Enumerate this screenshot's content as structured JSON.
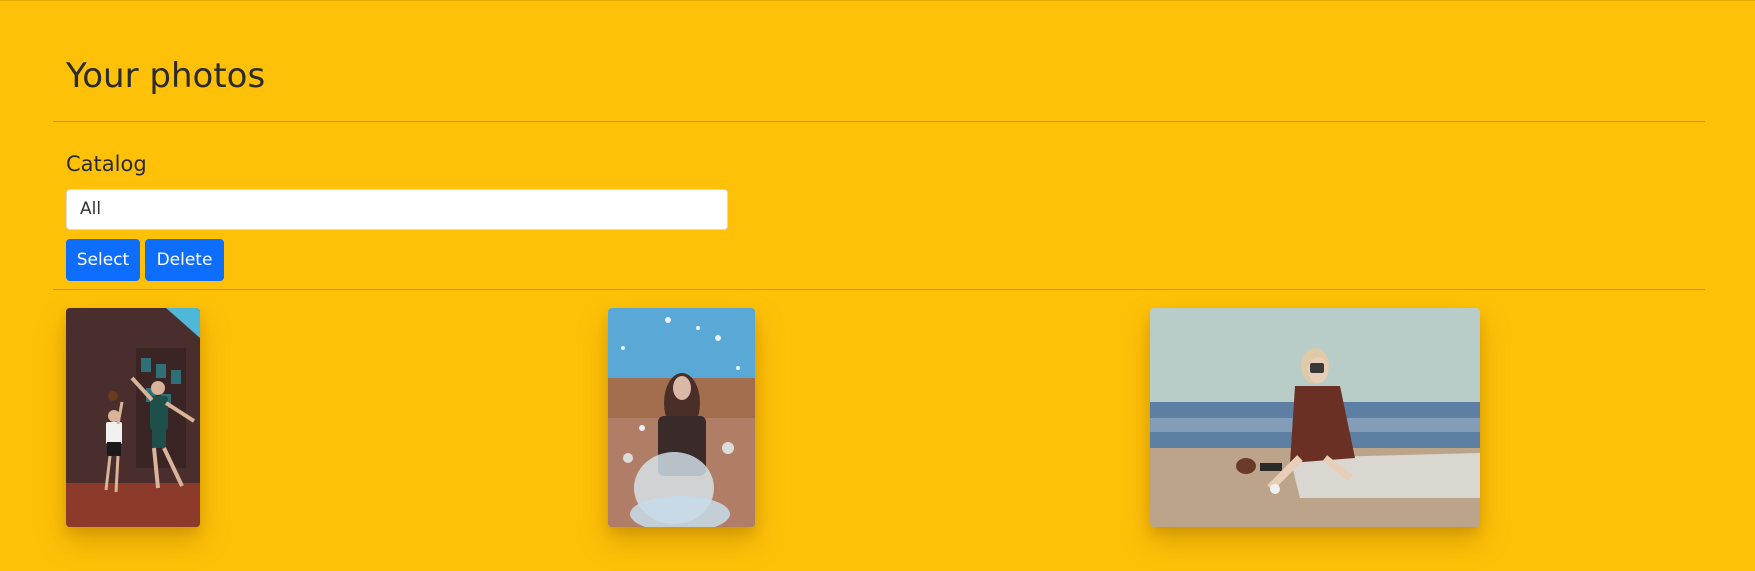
{
  "header": {
    "title": "Your photos"
  },
  "catalog": {
    "label": "Catalog",
    "selected": "All"
  },
  "actions": {
    "select_label": "Select",
    "delete_label": "Delete"
  },
  "photos": [
    {
      "subject": "basketball players jumping"
    },
    {
      "subject": "woman behind water splash"
    },
    {
      "subject": "woman with camera on beach"
    }
  ],
  "colors": {
    "background": "#ffc107",
    "button": "#0d6efd",
    "text": "#2b2b2b"
  }
}
